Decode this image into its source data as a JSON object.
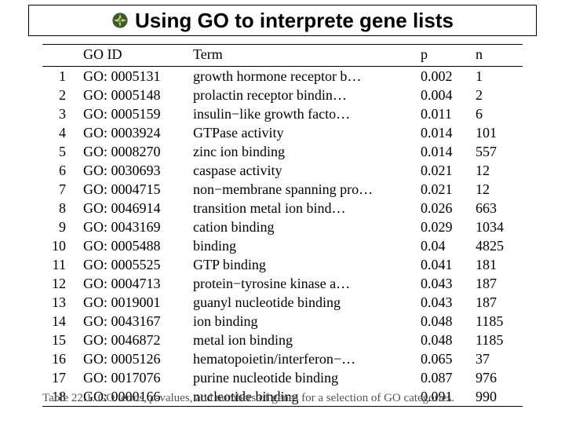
{
  "title": "Using GO to interprete gene lists",
  "bullet_icon_name": "sun-4-icon",
  "table": {
    "headers": {
      "idx": "",
      "goid": "GO ID",
      "term": "Term",
      "p": "p",
      "n": "n"
    },
    "rows": [
      {
        "idx": "1",
        "goid": "GO: 0005131",
        "term": "growth hormone receptor b…",
        "p": "0.002",
        "n": "1"
      },
      {
        "idx": "2",
        "goid": "GO: 0005148",
        "term": "prolactin receptor bindin…",
        "p": "0.004",
        "n": "2"
      },
      {
        "idx": "3",
        "goid": "GO: 0005159",
        "term": "insulin−like growth facto…",
        "p": "0.011",
        "n": "6"
      },
      {
        "idx": "4",
        "goid": "GO: 0003924",
        "term": "GTPase activity",
        "p": "0.014",
        "n": "101"
      },
      {
        "idx": "5",
        "goid": "GO: 0008270",
        "term": "zinc ion binding",
        "p": "0.014",
        "n": "557"
      },
      {
        "idx": "6",
        "goid": "GO: 0030693",
        "term": "caspase activity",
        "p": "0.021",
        "n": "12"
      },
      {
        "idx": "7",
        "goid": "GO: 0004715",
        "term": "non−membrane spanning pro…",
        "p": "0.021",
        "n": "12"
      },
      {
        "idx": "8",
        "goid": "GO: 0046914",
        "term": "transition metal ion bind…",
        "p": "0.026",
        "n": "663"
      },
      {
        "idx": "9",
        "goid": "GO: 0043169",
        "term": "cation binding",
        "p": "0.029",
        "n": "1034"
      },
      {
        "idx": "10",
        "goid": "GO: 0005488",
        "term": "binding",
        "p": "0.04",
        "n": "4825"
      },
      {
        "idx": "11",
        "goid": "GO: 0005525",
        "term": "GTP binding",
        "p": "0.041",
        "n": "181"
      },
      {
        "idx": "12",
        "goid": "GO: 0004713",
        "term": "protein−tyrosine kinase a…",
        "p": "0.043",
        "n": "187"
      },
      {
        "idx": "13",
        "goid": "GO: 0019001",
        "term": "guanyl nucleotide binding",
        "p": "0.043",
        "n": "187"
      },
      {
        "idx": "14",
        "goid": "GO: 0043167",
        "term": "ion binding",
        "p": "0.048",
        "n": "1185"
      },
      {
        "idx": "15",
        "goid": "GO: 0046872",
        "term": "metal ion binding",
        "p": "0.048",
        "n": "1185"
      },
      {
        "idx": "16",
        "goid": "GO: 0005126",
        "term": "hematopoietin/interferon−…",
        "p": "0.065",
        "n": "37"
      },
      {
        "idx": "17",
        "goid": "GO: 0017076",
        "term": "purine nucleotide binding",
        "p": "0.087",
        "n": "976"
      },
      {
        "idx": "18",
        "goid": "GO: 0000166",
        "term": "nucleotide binding",
        "p": "0.091",
        "n": "990"
      }
    ]
  },
  "caption_prefix": "Table 22.1. GO terms, ",
  "caption_pword": "p",
  "caption_suffix": "-values, and numbers of genes for a selection of GO categories.",
  "chart_data": {
    "type": "table",
    "title": "GO terms, p-values, and numbers of genes for a selection of GO categories",
    "columns": [
      "GO ID",
      "Term",
      "p",
      "n"
    ],
    "rows": [
      [
        "GO: 0005131",
        "growth hormone receptor b…",
        0.002,
        1
      ],
      [
        "GO: 0005148",
        "prolactin receptor bindin…",
        0.004,
        2
      ],
      [
        "GO: 0005159",
        "insulin−like growth facto…",
        0.011,
        6
      ],
      [
        "GO: 0003924",
        "GTPase activity",
        0.014,
        101
      ],
      [
        "GO: 0008270",
        "zinc ion binding",
        0.014,
        557
      ],
      [
        "GO: 0030693",
        "caspase activity",
        0.021,
        12
      ],
      [
        "GO: 0004715",
        "non−membrane spanning pro…",
        0.021,
        12
      ],
      [
        "GO: 0046914",
        "transition metal ion bind…",
        0.026,
        663
      ],
      [
        "GO: 0043169",
        "cation binding",
        0.029,
        1034
      ],
      [
        "GO: 0005488",
        "binding",
        0.04,
        4825
      ],
      [
        "GO: 0005525",
        "GTP binding",
        0.041,
        181
      ],
      [
        "GO: 0004713",
        "protein−tyrosine kinase a…",
        0.043,
        187
      ],
      [
        "GO: 0019001",
        "guanyl nucleotide binding",
        0.043,
        187
      ],
      [
        "GO: 0043167",
        "ion binding",
        0.048,
        1185
      ],
      [
        "GO: 0046872",
        "metal ion binding",
        0.048,
        1185
      ],
      [
        "GO: 0005126",
        "hematopoietin/interferon−…",
        0.065,
        37
      ],
      [
        "GO: 0017076",
        "purine nucleotide binding",
        0.087,
        976
      ],
      [
        "GO: 0000166",
        "nucleotide binding",
        0.091,
        990
      ]
    ]
  }
}
